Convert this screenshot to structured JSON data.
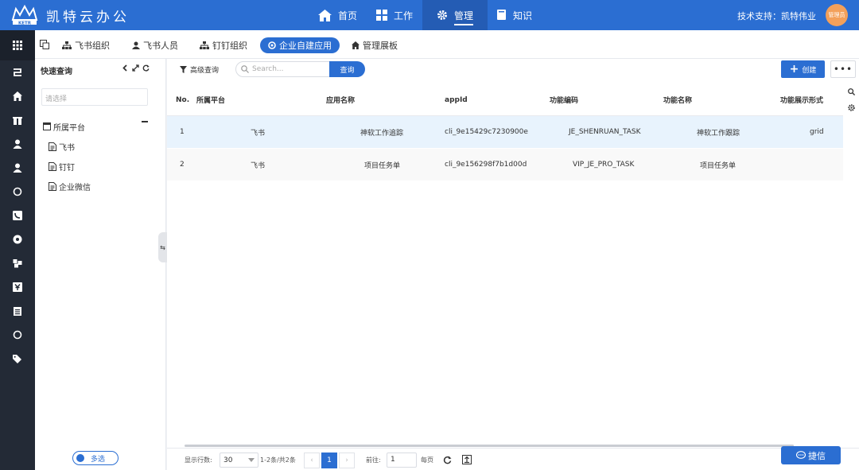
{
  "app": {
    "title": "凯特云办公",
    "logo_label": "KETR"
  },
  "nav": [
    {
      "label": "首页",
      "icon": "home-icon"
    },
    {
      "label": "工作",
      "icon": "apps-icon"
    },
    {
      "label": "管理",
      "icon": "gear-icon",
      "active": true
    },
    {
      "label": "知识",
      "icon": "book-icon"
    }
  ],
  "header": {
    "support": "技术支持：凯特伟业",
    "avatar_text": "管理员"
  },
  "tabs": [
    {
      "label": "飞书组织",
      "icon": "org-tree-icon"
    },
    {
      "label": "飞书人员",
      "icon": "user-icon"
    },
    {
      "label": "钉钉组织",
      "icon": "org-tree-icon"
    },
    {
      "label": "企业自建应用",
      "icon": "circle-gear-icon",
      "active": true
    },
    {
      "label": "管理展板",
      "icon": "home-icon"
    }
  ],
  "tree": {
    "title": "快速查询",
    "select_placeholder": "请选择",
    "root": "所属平台",
    "children": [
      "飞书",
      "钉钉",
      "企业微信"
    ],
    "multi_select": "多选"
  },
  "toolbar": {
    "advanced_query": "高级查询",
    "search_placeholder": "Search...",
    "search_button": "查询",
    "create_button": "创建",
    "more_button": "•••"
  },
  "table": {
    "headers": [
      "No.",
      "所属平台",
      "应用名称",
      "appId",
      "功能编码",
      "功能名称",
      "功能展示形式"
    ],
    "rows": [
      [
        "1",
        "飞书",
        "神软工作追踪",
        "cli_9e15429c7230900e",
        "JE_SHENRUAN_TASK",
        "神软工作跟踪",
        "grid"
      ],
      [
        "2",
        "飞书",
        "项目任务单",
        "cli_9e156298f7b1d00d",
        "VIP_JE_PRO_TASK",
        "项目任务单",
        ""
      ]
    ]
  },
  "footer": {
    "rows_label": "显示行数:",
    "rows_value": "30",
    "range": "1-2条/共2条",
    "current_page": "1",
    "goto_label": "前往:",
    "goto_value": "1",
    "per_page": "每页"
  },
  "feedback_button": "捷信",
  "colors": {
    "primary": "#2b6ed2",
    "rail": "#232a36",
    "selected_row": "#e8f3fd"
  }
}
